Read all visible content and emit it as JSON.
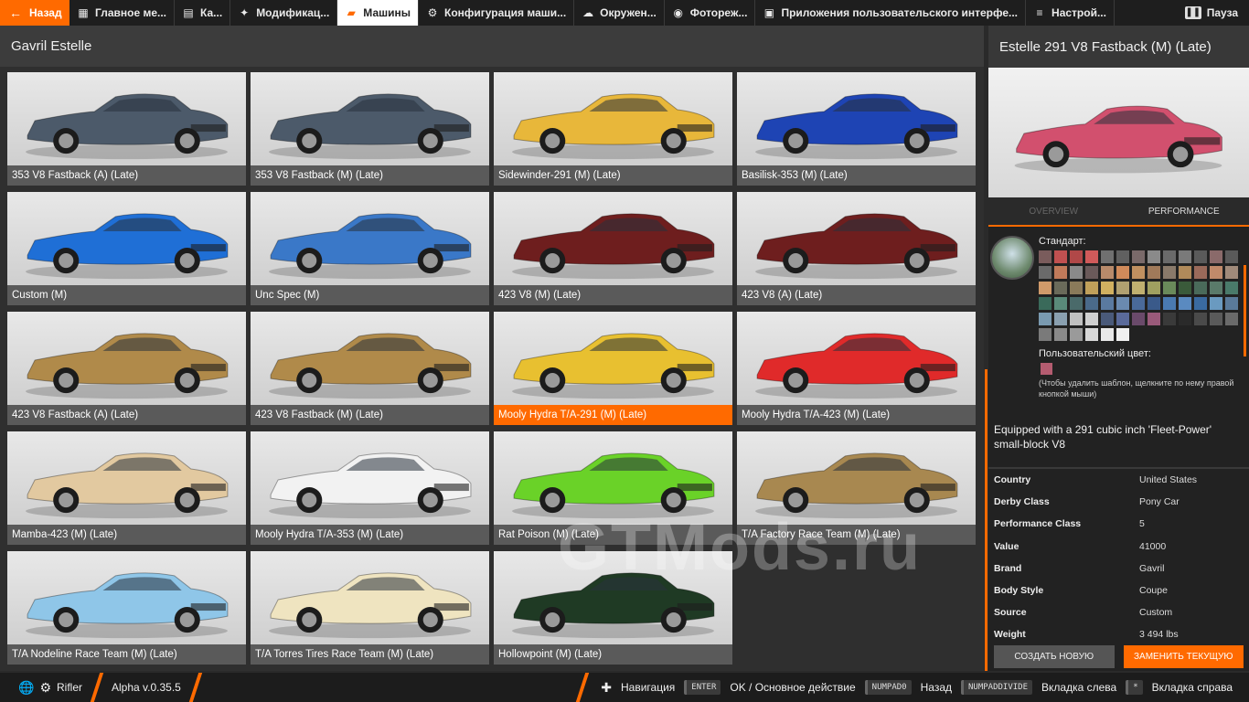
{
  "topbar": {
    "back_label": "Назад",
    "tabs": [
      {
        "label": "Главное ме...",
        "icon": "grid-icon"
      },
      {
        "label": "Ка...",
        "icon": "map-icon"
      },
      {
        "label": "Модификац...",
        "icon": "puzzle-icon"
      },
      {
        "label": "Машины",
        "icon": "car-icon",
        "active": true
      },
      {
        "label": "Конфигурация маши...",
        "icon": "car-config-icon"
      },
      {
        "label": "Окружен...",
        "icon": "weather-icon"
      },
      {
        "label": "Фотореж...",
        "icon": "camera-icon"
      },
      {
        "label": "Приложения пользовательского интерфе...",
        "icon": "apps-icon"
      },
      {
        "label": "Настрой...",
        "icon": "settings-sliders-icon"
      }
    ],
    "pause_label": "Пауза"
  },
  "main": {
    "title": "Gavril Estelle",
    "vehicles": [
      {
        "label": "353 V8 Fastback (A) (Late)",
        "color": "#4c5a6a"
      },
      {
        "label": "353 V8 Fastback (M) (Late)",
        "color": "#4c5a6a"
      },
      {
        "label": "Sidewinder-291 (M) (Late)",
        "color": "#e8b73a"
      },
      {
        "label": "Basilisk-353 (M) (Late)",
        "color": "#1e44b4"
      },
      {
        "label": "Custom (M)",
        "color": "#1f6fd6"
      },
      {
        "label": "Unc Spec (M)",
        "color": "#3a78c8"
      },
      {
        "label": "423 V8 (M) (Late)",
        "color": "#6e1e1e"
      },
      {
        "label": "423 V8 (A) (Late)",
        "color": "#6e1e1e"
      },
      {
        "label": "423 V8 Fastback (A) (Late)",
        "color": "#b08a4a"
      },
      {
        "label": "423 V8 Fastback (M) (Late)",
        "color": "#b08a4a"
      },
      {
        "label": "Mooly Hydra T/A-291 (M) (Late)",
        "color": "#e8c030",
        "selected": true
      },
      {
        "label": "Mooly Hydra T/A-423 (M) (Late)",
        "color": "#e02a2a"
      },
      {
        "label": "Mamba-423 (M) (Late)",
        "color": "#e2c9a0"
      },
      {
        "label": "Mooly Hydra T/A-353 (M) (Late)",
        "color": "#f2f2f2"
      },
      {
        "label": "Rat Poison (M) (Late)",
        "color": "#6ad228"
      },
      {
        "label": "T/A Factory Race Team (M) (Late)",
        "color": "#a88850"
      },
      {
        "label": "T/A Nodeline Race Team (M) (Late)",
        "color": "#8fc6e8"
      },
      {
        "label": "T/A Torres Tires Race Team (M) (Late)",
        "color": "#efe4c0"
      },
      {
        "label": "Hollowpoint (M) (Late)",
        "color": "#1f3a24"
      }
    ]
  },
  "side": {
    "title": "Estelle 291 V8 Fastback (M) (Late)",
    "photo_color": "#d2506e",
    "tabs": [
      "OVERVIEW",
      "PERFORMANCE"
    ],
    "standard_label": "Стандарт:",
    "custom_label": "Пользовательский цвет:",
    "hint": "(Чтобы удалить шаблон, щелкните по нему правой кнопкой мыши)",
    "swatches": [
      "#7a5c5c",
      "#c05050",
      "#b04848",
      "#d05a5a",
      "#707070",
      "#606060",
      "#7a6a6a",
      "#8a8a8a",
      "#6a6a6a",
      "#7a7a7a",
      "#5a5a5a",
      "#8a6a6a",
      "#5a5a5a",
      "#6a6a6a",
      "#c07a5a",
      "#8a8a8a",
      "#6a5a5a",
      "#b88a6a",
      "#d08a5a",
      "#c09060",
      "#a07a5a",
      "#8a7a6a",
      "#b08a5a",
      "#9a6a5a",
      "#c08a6a",
      "#a08a7a",
      "#d09a6a",
      "#6a6a5a",
      "#8a7a5a",
      "#c0a05a",
      "#d0b060",
      "#b0a070",
      "#c0b070",
      "#a0a060",
      "#6a8a5a",
      "#3a5a3a",
      "#4a6a5a",
      "#5a7a6a",
      "#4a7a6a",
      "#3a6a5a",
      "#5a8a7a",
      "#4a6a6a",
      "#4a6a8a",
      "#5a7aa0",
      "#6a8ab0",
      "#4a6a9a",
      "#3a5a8a",
      "#4a7ab0",
      "#5a8ac0",
      "#3a6aa0",
      "#6a9ac0",
      "#5a7a9a",
      "#7a9ab0",
      "#8aa0b0",
      "#c0c0c0",
      "#d0d0d0",
      "#4a5a7a",
      "#5a6a9a",
      "#6a4a6a",
      "#9a5a7a",
      "#3a3a3a",
      "#2a2a2a",
      "#4a4a4a",
      "#5a5a5a",
      "#6a6a6a",
      "#7a7a7a",
      "#8a8a8a",
      "#9a9a9a",
      "#d8d8d8",
      "#e8e8e8",
      "#f0f0f0"
    ],
    "custom_swatch": "#b45c70",
    "description": "Equipped with a 291 cubic inch 'Fleet-Power' small-block V8",
    "specs": [
      {
        "key": "Country",
        "value": "United States"
      },
      {
        "key": "Derby Class",
        "value": "Pony Car"
      },
      {
        "key": "Performance Class",
        "value": "5"
      },
      {
        "key": "Value",
        "value": "41000"
      },
      {
        "key": "Brand",
        "value": "Gavril"
      },
      {
        "key": "Body Style",
        "value": "Coupe"
      },
      {
        "key": "Source",
        "value": "Custom"
      },
      {
        "key": "Weight",
        "value": "3 494 lbs"
      }
    ],
    "create_label": "СОЗДАТЬ НОВУЮ",
    "replace_label": "ЗАМЕНИТЬ ТЕКУЩУЮ"
  },
  "bottombar": {
    "user": "Rifler",
    "version": "Alpha v.0.35.5",
    "navigation_label": "Навигация",
    "hints": [
      {
        "key": "ENTER",
        "label": "OK / Основное действие"
      },
      {
        "key": "NUMPAD0",
        "label": "Назад"
      },
      {
        "key": "NUMPADDIVIDE",
        "label": "Вкладка слева"
      },
      {
        "key": "*",
        "label": "Вкладка справа"
      }
    ]
  },
  "watermark": "GTMods.ru"
}
